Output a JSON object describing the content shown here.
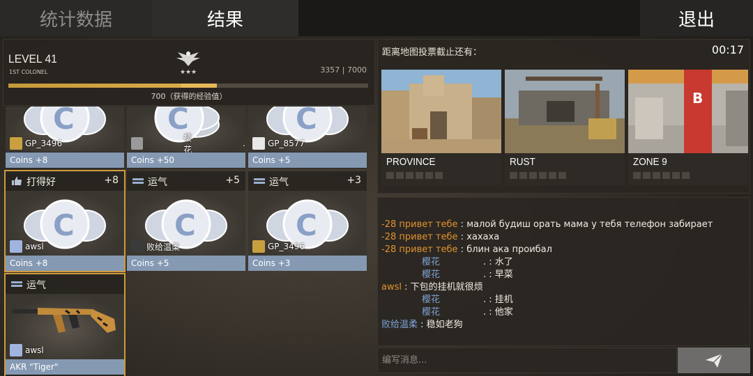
{
  "tabs": {
    "stats": "统计数据",
    "results": "结果",
    "exit": "退出"
  },
  "level": {
    "title": "LEVEL 41",
    "rank": "1ST COLONEL",
    "xp_current": "3357 | 7000",
    "xp_progress": 0.48,
    "xp_gain_progress": 0.1,
    "xp_gain_text": "700（获得的经验值）",
    "rank_icon": "eagle-stars-icon"
  },
  "cards": [
    {
      "user": "GP_3496",
      "foot": "Coins +8",
      "avatar_color": "#c8a040"
    },
    {
      "user": "樱花",
      "foot": "Coins +50",
      "avatar_color": "#9a9a9a",
      "suffix": "."
    },
    {
      "user": "GP_8577",
      "foot": "Coins +5",
      "avatar_color": "#e8e8e8"
    },
    {
      "head": "打得好",
      "head_icon": "thumbs-up-icon",
      "value": "+8",
      "user": "awsl",
      "foot": "Coins +8",
      "avatar_color": "#a0b4e0"
    },
    {
      "head": "运气",
      "head_icon": "luck-icon",
      "value": "+5",
      "user": "败给温柔",
      "foot": "Coins +5",
      "avatar_color": "#3a3a3a"
    },
    {
      "head": "运气",
      "head_icon": "luck-icon",
      "value": "+3",
      "user": "GP_3496",
      "foot": "Coins +3",
      "avatar_color": "#c8a040"
    },
    {
      "head": "运气",
      "head_icon": "luck-icon",
      "user": "awsl",
      "foot": "AKR \"Tiger\"",
      "avatar_color": "#a0b4e0"
    }
  ],
  "vote": {
    "title": "距离地图投票截止还有：",
    "timer": "00:17",
    "maps": [
      {
        "name": "PROVINCE"
      },
      {
        "name": "RUST"
      },
      {
        "name": "ZONE 9"
      }
    ]
  },
  "chat": {
    "lines": [
      {
        "name": "-28 привет тебе",
        "sep": " : ",
        "msg": "малой будиш орать мама у тебя телефон забирает"
      },
      {
        "name": "-28 привет тебе",
        "sep": " : ",
        "msg": "хахаха"
      },
      {
        "name": "-28 привет тебе",
        "sep": " : ",
        "msg": "блин ака проибал"
      },
      {
        "name": "樱花",
        "sep": ". : ",
        "msg": "水了"
      },
      {
        "name": "樱花",
        "sep": ". : ",
        "msg": "早菜"
      },
      {
        "name": "awsl",
        "sep": " : ",
        "msg": "下包的挂机就很烦"
      },
      {
        "name": "樱花",
        "sep": ". : ",
        "msg": "挂机"
      },
      {
        "name": "樱花",
        "sep": ". : ",
        "msg": "他家"
      },
      {
        "name": "败给温柔",
        "sep": " : ",
        "msg": "稳如老狗"
      }
    ],
    "input_placeholder": "编写消息..."
  },
  "colors": {
    "accent": "#d09a3a",
    "coin_footer": "#8599b3",
    "chat_orange": "#e0932e",
    "chat_blue": "#7fa3d6"
  }
}
